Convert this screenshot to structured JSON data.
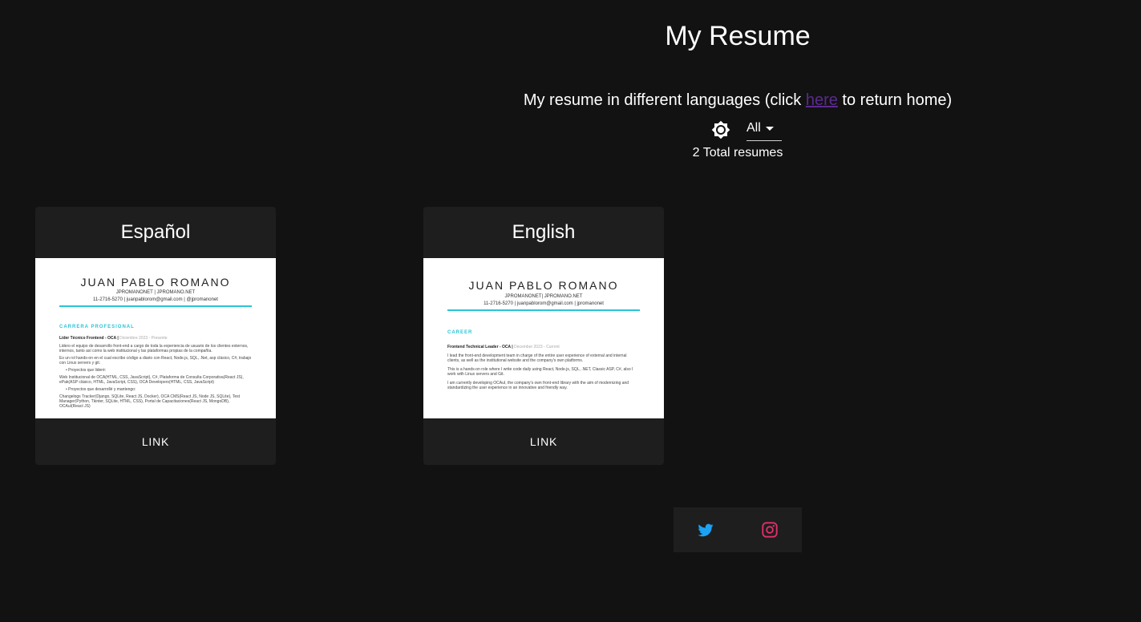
{
  "header": {
    "title": "My Resume",
    "subtitle_before": "My resume in different languages (click ",
    "subtitle_link": "here",
    "subtitle_after": " to return home)"
  },
  "filter": {
    "selected": "All",
    "theme_icon": "brightness-icon"
  },
  "count_text": "2 Total resumes",
  "cards": [
    {
      "title": "Español",
      "action": "LINK",
      "preview": {
        "name": "JUAN PABLO ROMANO",
        "links": "JPROMANONET | JPROMANO.NET",
        "contact": "11-2716-5270 | juanpablorom@gmail.com | @jpromanonet",
        "section": "CARRERA PROFESIONAL",
        "role": "Líder Técnico Frontend - OCA |",
        "date": "Diciembre 2023 - Presente",
        "p1": "Lidero el equipo de desarrollo front-end a cargo de toda la experiencia de usuario de los clientes externos, internos, tanto así como la web institucional y las plataformas propias de la compañía.",
        "p2": "Es un rol hands-on en el cual escribo código a diario con React, Node.js, SQL, .Net, asp clásico, C#, trabajo con Linux servers y git.",
        "b1": "Proyectos que lideré:",
        "p3": "Web Institucional de OCA(HTML, CSS, JavaScript), C#, Plataforma de Consulta Corporativa(React JS), ePak(ASP clásico, HTML, JavaScript, CSS), OCA Developers(HTML, CSS, JavaScript)",
        "b2": "Proyectos que desarrollé y mantengo:",
        "p4": "Changelogs Tracker(Django, SQLite, React JS, Docker), OCA CMS(React JS, Node JS, SQLite), Test Manager(Python, Tkinter, SQLite, HTML, CSS), Portal de Capacitaciones(React JS, MongoDB), OCAuI(React JS)"
      }
    },
    {
      "title": "English",
      "action": "LINK",
      "preview": {
        "name": "JUAN PABLO ROMANO",
        "links": "JPROMANONET| JPROMANO.NET",
        "contact": "11-2716-5270 | juanpablorom@gmail.com | jpromanonet",
        "section": "CAREER",
        "role": "Frontend Technical Leader - OCA |",
        "date": "December 2023 - Current",
        "p1": "I lead the front-end development team in charge of the entire user experience of external and internal clients, as well as the institutional website and the company's own platforms.",
        "p2": "This is a hands-on role where I write code daily using React, Node.js, SQL, .NET, Classic ASP, C#, also I work with Linux servers and Git.",
        "p3": "I am currently developing OCAuI, the company's own front-end library with the aim of modernizing and standardizing the user experience in an innovative and friendly way."
      }
    }
  ],
  "social": {
    "twitter_icon": "twitter-icon",
    "instagram_icon": "instagram-icon",
    "twitter_color": "#1da1f2",
    "instagram_color": "#e1306c"
  }
}
